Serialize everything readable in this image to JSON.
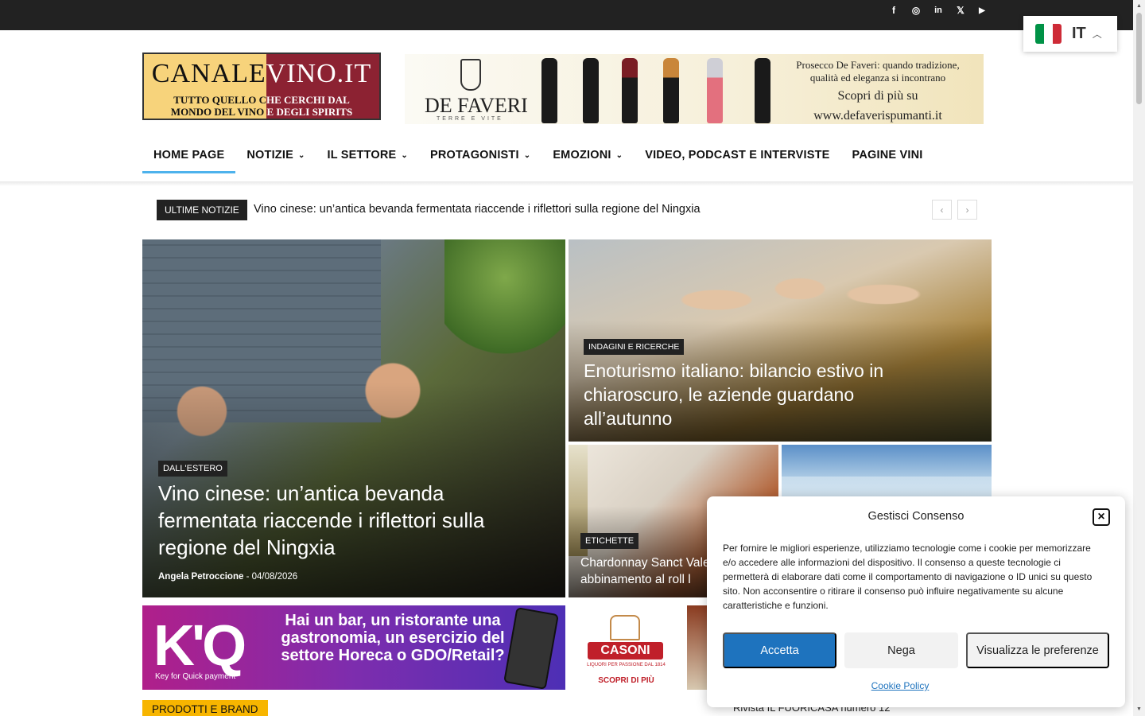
{
  "topbar": {
    "social": [
      "facebook-icon",
      "instagram-icon",
      "linkedin-icon",
      "x-icon",
      "youtube-icon"
    ],
    "social_glyphs": [
      "f",
      "◎",
      "in",
      "𝕏",
      "▶"
    ]
  },
  "language": {
    "code": "IT",
    "caret": "^"
  },
  "logo": {
    "name_left": "CANALE",
    "name_right": "VINO.IT",
    "tagline_l1_left": "TUTTO QUELLO C",
    "tagline_l1_right": "HE CERCHI DAL",
    "tagline_l2_left": "MONDO DEL VINO",
    "tagline_l2_right": " E DEGLI SPIRITS"
  },
  "banner": {
    "brand": "DE FAVERI",
    "tag": "TERRE E VITE",
    "line1": "Prosecco De Faveri: quando tradizione,",
    "line2": "qualità ed eleganza si incontrano",
    "line3": "Scopri di più su",
    "line4": "www.defaverispumanti.it"
  },
  "nav": [
    {
      "label": "HOME PAGE"
    },
    {
      "label": "NOTIZIE"
    },
    {
      "label": "IL SETTORE"
    },
    {
      "label": "PROTAGONISTI"
    },
    {
      "label": "EMOZIONI"
    },
    {
      "label": "VIDEO, PODCAST E INTERVISTE"
    },
    {
      "label": "PAGINE VINI"
    }
  ],
  "ticker": {
    "label": "ULTIME NOTIZIE",
    "text": "Vino cinese: un’antica bevanda fermentata riaccende i riflettori sulla regione del Ningxia",
    "prev": "‹",
    "next": "›"
  },
  "featured": {
    "main": {
      "category": "DALL'ESTERO",
      "title": "Vino cinese: un’antica bevanda fermentata riaccende i riflettori sulla regione del Ningxia",
      "author": "Angela Petroccione",
      "separator": "-",
      "date": "04/08/2026"
    },
    "top_right": {
      "category": "INDAGINI E RICERCHE",
      "title": "Enoturismo italiano: bilancio estivo in chiaroscuro, le aziende guardano all’autunno"
    },
    "bottom_left": {
      "category": "ETICHETTE",
      "title": "Chardonnay Sanct Vale in abbinamento al roll l"
    }
  },
  "ads": {
    "kq_logo": "K'Q",
    "kq_sub": "Key for Quick payment",
    "kq_text": "Hai un bar, un ristorante una gastronomia, un esercizio del settore Horeca o GDO/Retail?",
    "casoni_name": "CASONI",
    "casoni_sub": "LIQUORI PER PASSIONE DAL 1814",
    "casoni_cta": "SCOPRI DI PIÙ"
  },
  "section": {
    "label": "PRODOTTI E BRAND"
  },
  "side_link": "Rivista IL FUORICASA numero 12",
  "consent": {
    "title": "Gestisci Consenso",
    "close": "×",
    "body": "Per fornire le migliori esperienze, utilizziamo tecnologie come i cookie per memorizzare e/o accedere alle informazioni del dispositivo. Il consenso a queste tecnologie ci permetterà di elaborare dati come il comportamento di navigazione o ID unici su questo sito. Non acconsentire o ritirare il consenso può influire negativamente su alcune caratteristiche e funzioni.",
    "accept": "Accetta",
    "deny": "Nega",
    "preferences": "Visualizza le preferenze",
    "policy": "Cookie Policy"
  },
  "colors": {
    "accent": "#4db2ec",
    "consent_primary": "#1e73be",
    "section_tag": "#f7b500",
    "dark": "#222222"
  }
}
